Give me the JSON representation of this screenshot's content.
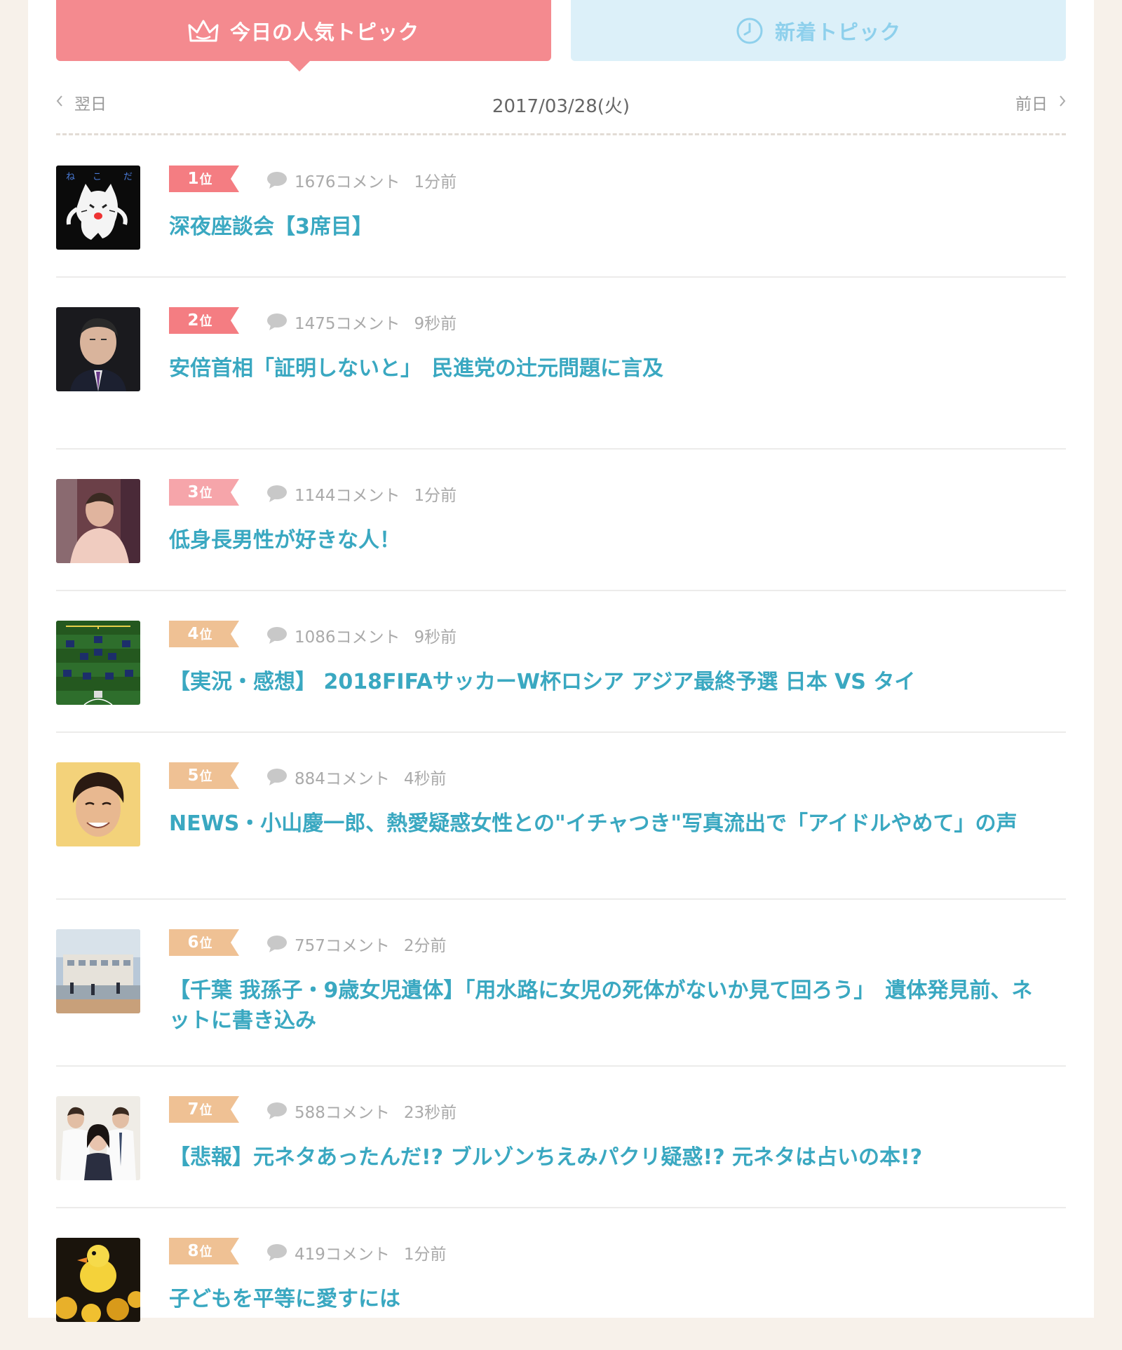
{
  "tabs": {
    "popular_label": "今日の人気トピック",
    "new_label": "新着トピック"
  },
  "date_nav": {
    "next_day_label": "翌日",
    "date": "2017/03/28(火)",
    "prev_day_label": "前日"
  },
  "comment_suffix": "コメント",
  "rank_suffix": "位",
  "colors": {
    "rank_red": "#f47d82",
    "rank_pink": "#f6a5aa",
    "rank_orange": "#efc194",
    "title_blue": "#3aa8c1",
    "tab_popular": "#f48a8f",
    "tab_new": "#dcf0f9"
  },
  "topics": [
    {
      "rank": "1",
      "comments": "1676コメント",
      "time": "1分前",
      "title": "深夜座談会【3席目】",
      "thumb": "ghost-cat-icon"
    },
    {
      "rank": "2",
      "comments": "1475コメント",
      "time": "9秒前",
      "title": "安倍首相「証明しないと」　民進党の辻元問題に言及",
      "thumb": "man-portrait"
    },
    {
      "rank": "3",
      "comments": "1144コメント",
      "time": "1分前",
      "title": "低身長男性が好きな人！",
      "thumb": "person-photo"
    },
    {
      "rank": "4",
      "comments": "1086コメント",
      "time": "9秒前",
      "title": "【実況・感想】 2018FIFAサッカーW杯ロシア アジア最終予選 日本 VS タイ",
      "thumb": "soccer-formation"
    },
    {
      "rank": "5",
      "comments": "884コメント",
      "time": "4秒前",
      "title": "NEWS・小山慶一郎、熱愛疑惑女性との\"イチャつき\"写真流出で「アイドルやめて」の声",
      "thumb": "smiling-man"
    },
    {
      "rank": "6",
      "comments": "757コメント",
      "time": "2分前",
      "title": "【千葉 我孫子・9歳女児遺体】「用水路に女児の死体がないか見て回ろう」　遺体発見前、ネットに書き込み",
      "thumb": "school-building"
    },
    {
      "rank": "7",
      "comments": "588コメント",
      "time": "23秒前",
      "title": "【悲報】元ネタあったんだ!? ブルゾンちえみパクリ疑惑!? 元ネタは占いの本!?",
      "thumb": "three-people"
    },
    {
      "rank": "8",
      "comments": "419コメント",
      "time": "1分前",
      "title": "子どもを平等に愛すには",
      "thumb": "rubber-ducks"
    }
  ]
}
